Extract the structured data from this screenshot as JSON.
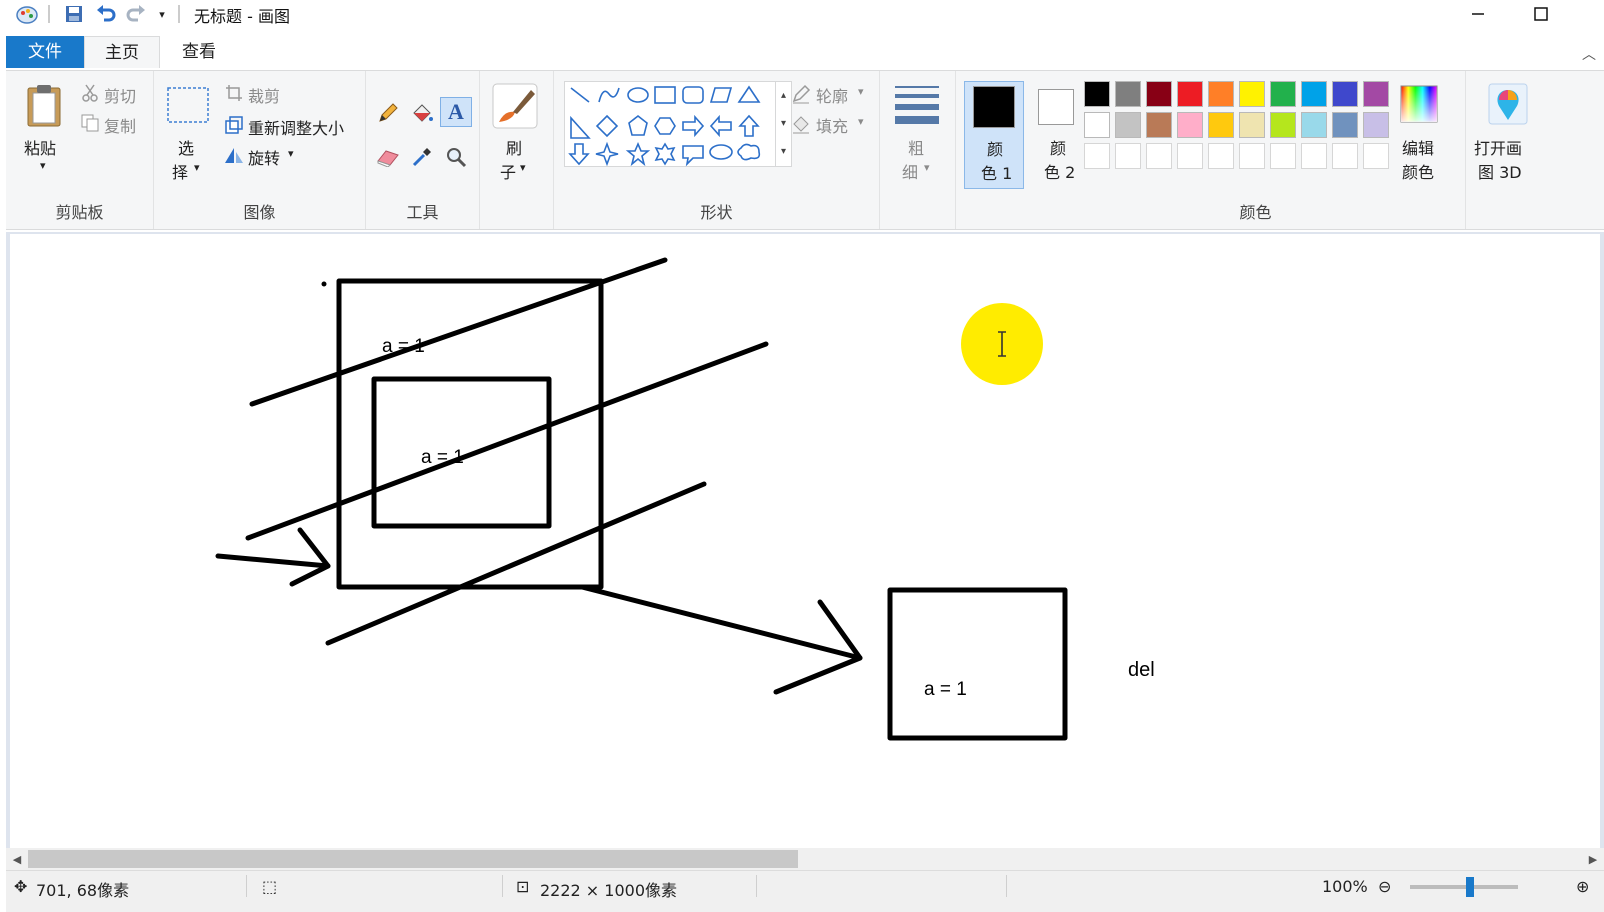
{
  "window": {
    "title": "无标题 - 画图",
    "minimize_icon": "minimize-icon",
    "maximize_icon": "maximize-icon"
  },
  "tabs": [
    {
      "label": "文件"
    },
    {
      "label": "主页"
    },
    {
      "label": "查看"
    }
  ],
  "clipboard": {
    "paste": "粘贴",
    "cut": "剪切",
    "copy": "复制",
    "group": "剪贴板"
  },
  "image": {
    "select_top": "选",
    "select_bottom": "择",
    "crop": "裁剪",
    "resize": "重新调整大小",
    "rotate": "旋转",
    "group": "图像"
  },
  "tools": {
    "group": "工具",
    "brush_top": "刷",
    "brush_bottom": "子"
  },
  "shapes": {
    "outline": "轮廓",
    "fill": "填充",
    "group": "形状"
  },
  "size": {
    "top": "粗",
    "bottom": "细"
  },
  "colors": {
    "color1_top": "颜",
    "color1_bottom": "色 1",
    "color2_top": "颜",
    "color2_bottom": "色 2",
    "edit_top": "编辑",
    "edit_bottom": "颜色",
    "paint3d_top": "打开画",
    "paint3d_bottom": "图 3D",
    "group": "颜色",
    "color1": "#000000",
    "color2": "#ffffff",
    "palette_row1": [
      "#000000",
      "#7f7f7f",
      "#880015",
      "#ed1c24",
      "#ff7f27",
      "#fff200",
      "#22b14c",
      "#00a2e8",
      "#3f48cc",
      "#a349a4"
    ],
    "palette_row2": [
      "#ffffff",
      "#c3c3c3",
      "#b97a57",
      "#ffaec9",
      "#ffc90e",
      "#efe4b0",
      "#b5e61d",
      "#99d9ea",
      "#7092be",
      "#c8bfe7"
    ]
  },
  "canvas": {
    "label1": "a = 1",
    "label2": "a = 1",
    "label3": "a = 1",
    "del": "del"
  },
  "statusbar": {
    "cursor_pos": "701, 68像素",
    "canvas_size": "2222 × 1000像素",
    "zoom": "100%"
  }
}
